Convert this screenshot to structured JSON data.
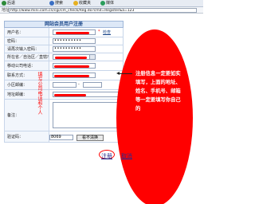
{
  "browser": {
    "back": "后退",
    "search": "搜索",
    "favorites": "收藏夹",
    "media": "媒体",
    "address_label": "地址",
    "url": "http://www.mini.com.cn/cgi/cm_check/Reg.do?cmd=Register&a=123"
  },
  "form": {
    "title": "网站会员用户注册",
    "check_link": "检查",
    "fields": {
      "username": "用户名：",
      "password": "密码：",
      "confirm_password": "请再次输入密码：",
      "province": "所在省／自治区／直辖市：",
      "phone": "移动公司电话：",
      "contact": "联系方式：",
      "postcode": "小区邮编：",
      "address": "地址邮编：",
      "remark": "备注：",
      "captcha": "验证码："
    },
    "password_mask": "••••••••••",
    "confirm_mask": "••••••••••",
    "captcha_value": "8069",
    "captcha_image": "看不清换"
  },
  "annotations": {
    "vertical_note": "填写公司电话和个人",
    "callout": "注册信息一定要如实填写，上面的地址、姓名、手机号、邮箱等一定要填写你自己的"
  },
  "buttons": {
    "register": "注册",
    "cancel": "取消"
  },
  "colors": {
    "highlight": "#ff0000",
    "header_bg": "#dde8f7",
    "label_bg": "#f2f6fc"
  }
}
